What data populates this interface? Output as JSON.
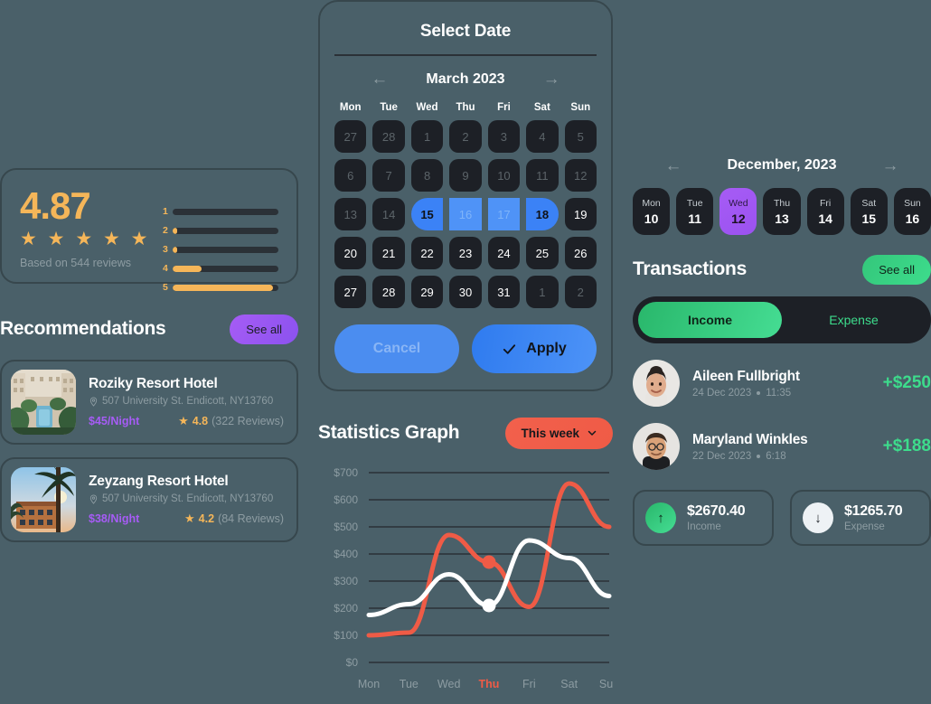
{
  "theme": {
    "background": "#4a6069",
    "card_border": "#37474d",
    "cell_dark": "#1d2026",
    "accent_amber": "#f5b659",
    "accent_purple": "#a65cf5",
    "accent_blue": "#3b82f6",
    "accent_green": "#3ddc8c",
    "accent_red": "#ef5b46",
    "muted_text": "#8d9ca2"
  },
  "rating": {
    "score": "4.87",
    "stars": "★ ★ ★ ★ ★",
    "basis": "Based on 544 reviews",
    "bars": [
      {
        "label": "1",
        "percent": 0
      },
      {
        "label": "2",
        "percent": 4
      },
      {
        "label": "3",
        "percent": 4
      },
      {
        "label": "4",
        "percent": 27
      },
      {
        "label": "5",
        "percent": 95
      }
    ]
  },
  "recommendations": {
    "title": "Recommendations",
    "see_all_label": "See all",
    "hotels": [
      {
        "name": "Roziky Resort Hotel",
        "address": "507 University St. Endicott, NY13760",
        "price": "$45/Night",
        "rating": "4.8",
        "reviews": "(322 Reviews)",
        "thumb": "resort-pool-courtyard"
      },
      {
        "name": "Zeyzang Resort Hotel",
        "address": "507 University St. Endicott, NY13760",
        "price": "$38/Night",
        "rating": "4.2",
        "reviews": "(84 Reviews)",
        "thumb": "palm-tree-sunset-hotel"
      }
    ]
  },
  "calendar": {
    "title": "Select Date",
    "month": "March 2023",
    "prev_icon": "arrow-left-icon",
    "next_icon": "arrow-right-icon",
    "day_names": [
      "Mon",
      "Tue",
      "Wed",
      "Thu",
      "Fri",
      "Sat",
      "Sun"
    ],
    "days": [
      {
        "n": "27",
        "state": "muted"
      },
      {
        "n": "28",
        "state": "muted"
      },
      {
        "n": "1",
        "state": "muted"
      },
      {
        "n": "2",
        "state": "muted"
      },
      {
        "n": "3",
        "state": "muted"
      },
      {
        "n": "4",
        "state": "muted"
      },
      {
        "n": "5",
        "state": "muted"
      },
      {
        "n": "6",
        "state": "muted"
      },
      {
        "n": "7",
        "state": "muted"
      },
      {
        "n": "8",
        "state": "muted"
      },
      {
        "n": "9",
        "state": "muted"
      },
      {
        "n": "10",
        "state": "muted"
      },
      {
        "n": "11",
        "state": "muted"
      },
      {
        "n": "12",
        "state": "muted"
      },
      {
        "n": "13",
        "state": "muted"
      },
      {
        "n": "14",
        "state": "muted"
      },
      {
        "n": "15",
        "state": "range-start"
      },
      {
        "n": "16",
        "state": "range-mid"
      },
      {
        "n": "17",
        "state": "range-mid"
      },
      {
        "n": "18",
        "state": "range-end"
      },
      {
        "n": "19",
        "state": "normal"
      },
      {
        "n": "20",
        "state": "normal"
      },
      {
        "n": "21",
        "state": "normal"
      },
      {
        "n": "22",
        "state": "normal"
      },
      {
        "n": "23",
        "state": "normal"
      },
      {
        "n": "24",
        "state": "normal"
      },
      {
        "n": "25",
        "state": "normal"
      },
      {
        "n": "26",
        "state": "normal"
      },
      {
        "n": "27",
        "state": "normal"
      },
      {
        "n": "28",
        "state": "normal"
      },
      {
        "n": "29",
        "state": "normal"
      },
      {
        "n": "30",
        "state": "normal"
      },
      {
        "n": "31",
        "state": "normal"
      },
      {
        "n": "1",
        "state": "muted"
      },
      {
        "n": "2",
        "state": "muted"
      }
    ],
    "cancel_label": "Cancel",
    "apply_label": "Apply",
    "apply_icon": "check-icon"
  },
  "statistics": {
    "title": "Statistics Graph",
    "period_label": "This week",
    "period_icon": "chevron-down-icon"
  },
  "chart_data": {
    "type": "line",
    "title": "Statistics Graph",
    "xlabel": "",
    "ylabel": "",
    "categories": [
      "Mon",
      "Tue",
      "Wed",
      "Thu",
      "Fri",
      "Sat",
      "Sun"
    ],
    "y_ticks": [
      "$0",
      "$100",
      "$200",
      "$300",
      "$400",
      "$500",
      "$600",
      "$700"
    ],
    "ylim": [
      0,
      700
    ],
    "grid": true,
    "legend": "none",
    "highlighted_category": "Thu",
    "series": [
      {
        "name": "primary",
        "color": "#ef5b46",
        "values": [
          100,
          110,
          470,
          370,
          205,
          660,
          500
        ],
        "marker": {
          "category": "Thu",
          "value": 370
        }
      },
      {
        "name": "secondary",
        "color": "#ffffff",
        "values": [
          175,
          215,
          325,
          210,
          450,
          385,
          245
        ],
        "marker": {
          "category": "Thu",
          "value": 210
        }
      }
    ]
  },
  "week": {
    "month": "December, 2023",
    "prev_icon": "arrow-left-icon",
    "next_icon": "arrow-right-icon",
    "days": [
      {
        "dow": "Mon",
        "num": "10",
        "active": false
      },
      {
        "dow": "Tue",
        "num": "11",
        "active": false
      },
      {
        "dow": "Wed",
        "num": "12",
        "active": true
      },
      {
        "dow": "Thu",
        "num": "13",
        "active": false
      },
      {
        "dow": "Fri",
        "num": "14",
        "active": false
      },
      {
        "dow": "Sat",
        "num": "15",
        "active": false
      },
      {
        "dow": "Sun",
        "num": "16",
        "active": false
      }
    ]
  },
  "transactions": {
    "title": "Transactions",
    "see_all_label": "See all",
    "toggle": {
      "income_label": "Income",
      "expense_label": "Expense",
      "selected": "Income"
    },
    "rows": [
      {
        "name": "Aileen Fullbright",
        "date": "24 Dec 2023",
        "time": "11:35",
        "amount": "+$250",
        "avatar": "woman-smiling-avatar"
      },
      {
        "name": "Maryland Winkles",
        "date": "22 Dec 2023",
        "time": "6:18",
        "amount": "+$188",
        "avatar": "man-glasses-avatar"
      }
    ],
    "summary": [
      {
        "amount": "$2670.40",
        "label": "Income",
        "icon": "arrow-up-icon",
        "kind": "income"
      },
      {
        "amount": "$1265.70",
        "label": "Expense",
        "icon": "arrow-down-icon",
        "kind": "expense"
      }
    ]
  }
}
